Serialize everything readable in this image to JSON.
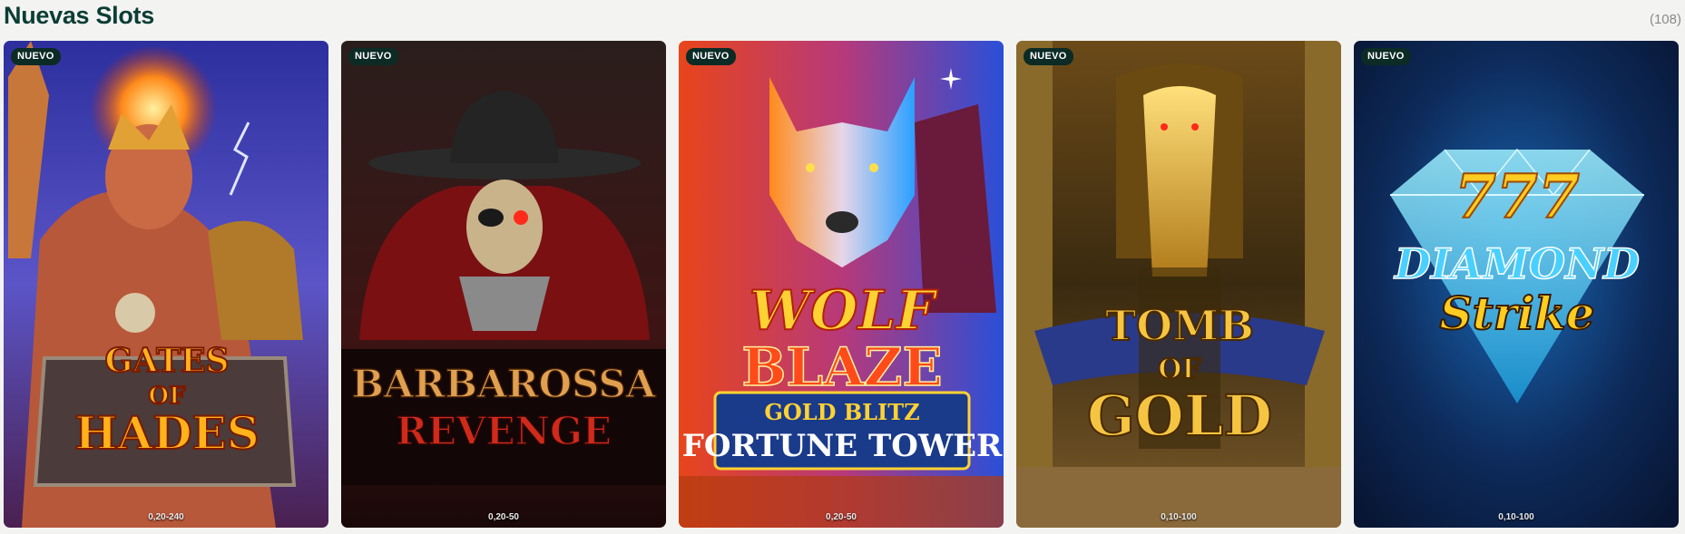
{
  "section": {
    "title": "Nuevas Slots",
    "count": "(108)"
  },
  "games": [
    {
      "id": "gates-of-hades",
      "badge": "NUEVO",
      "logo_lines": [
        "GATES",
        "OF",
        "HADES"
      ],
      "bet_range": "0,20-240",
      "colors": {
        "bg_top": "#3a3fb8",
        "bg_bottom": "#5b2a6e",
        "logo": "#ffb21a"
      }
    },
    {
      "id": "barbarossa-revenge",
      "badge": "NUEVO",
      "logo_lines": [
        "BARBAROSSA",
        "REVENGE"
      ],
      "bet_range": "0,20-50",
      "colors": {
        "bg_top": "#2b1a18",
        "bg_bottom": "#3a0d0d",
        "logo": "#e0a050"
      }
    },
    {
      "id": "wolf-blaze",
      "badge": "NUEVO",
      "logo_lines": [
        "WOLF",
        "BLAZE",
        "GOLD BLITZ",
        "FORTUNE TOWER"
      ],
      "bet_range": "0,20-50",
      "colors": {
        "bg_left": "#e8451a",
        "bg_right": "#1f7be8",
        "logo": "#ffd233"
      }
    },
    {
      "id": "tomb-of-gold-2",
      "badge": "NUEVO",
      "logo_lines": [
        "TOMB",
        "OF",
        "GOLD"
      ],
      "bet_range": "0,10-100",
      "colors": {
        "bg_top": "#5a3b10",
        "bg_bottom": "#2a1c08",
        "logo": "#f5c542"
      }
    },
    {
      "id": "777-diamond-strike",
      "badge": "NUEVO",
      "logo_lines": [
        "777",
        "DIAMOND",
        "Strike"
      ],
      "bet_range": "0,10-100",
      "colors": {
        "bg_top": "#0d2a5a",
        "bg_bottom": "#0a1a3a",
        "logo": "#ffcc22"
      }
    }
  ]
}
